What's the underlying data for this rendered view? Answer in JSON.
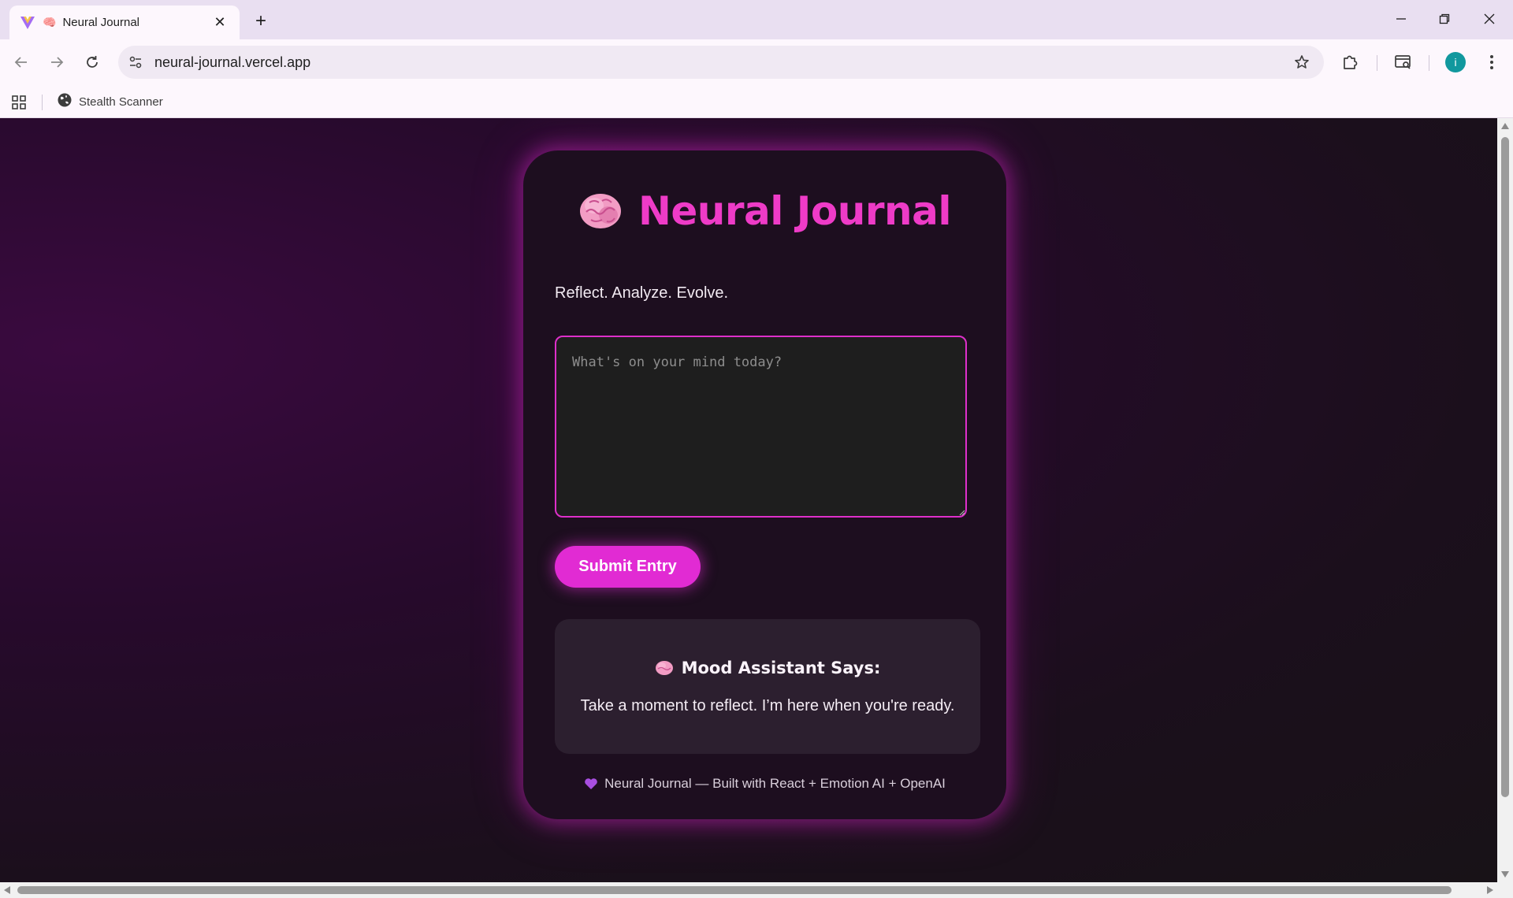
{
  "browser": {
    "tab_title": "Neural Journal",
    "tab_emoji": "🧠",
    "url": "neural-journal.vercel.app",
    "bookmarks": [
      {
        "label": "Stealth Scanner"
      }
    ],
    "profile_initial": "i"
  },
  "page": {
    "title": "Neural Journal",
    "tagline": "Reflect. Analyze. Evolve.",
    "entry_placeholder": "What's on your mind today?",
    "submit_label": "Submit Entry",
    "assistant": {
      "title": "Mood Assistant Says:",
      "message": "Take a moment to reflect. I’m here when you're ready."
    },
    "footer": "Neural Journal — Built with React + Emotion AI + OpenAI"
  },
  "colors": {
    "accent": "#e12bd3",
    "title": "#ee3bc7",
    "card": "#1d0e1f",
    "assistant_panel": "#2c1f2f"
  }
}
